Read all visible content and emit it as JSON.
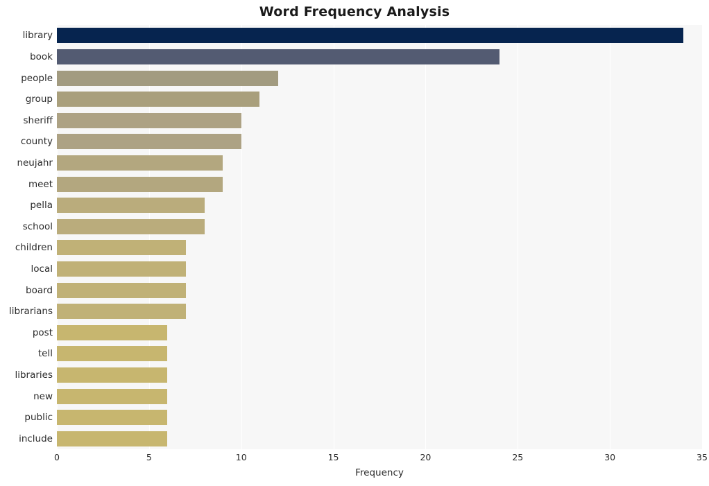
{
  "chart_data": {
    "type": "bar",
    "orientation": "horizontal",
    "title": "Word Frequency Analysis",
    "xlabel": "Frequency",
    "ylabel": "",
    "xlim": [
      0,
      35
    ],
    "xticks": [
      0,
      5,
      10,
      15,
      20,
      25,
      30,
      35
    ],
    "grid": true,
    "legend": null,
    "categories": [
      "library",
      "book",
      "people",
      "group",
      "sheriff",
      "county",
      "neujahr",
      "meet",
      "pella",
      "school",
      "children",
      "local",
      "board",
      "librarians",
      "post",
      "tell",
      "libraries",
      "new",
      "public",
      "include"
    ],
    "values": [
      34,
      24,
      12,
      11,
      10,
      10,
      9,
      9,
      8,
      8,
      7,
      7,
      7,
      7,
      6,
      6,
      6,
      6,
      6,
      6
    ],
    "bar_colors": [
      "#06244f",
      "#535b72",
      "#a29b80",
      "#a99f7c",
      "#ada284",
      "#ada284",
      "#b3a77f",
      "#b3a77f",
      "#baac7c",
      "#baac7c",
      "#c0b177",
      "#c0b177",
      "#c0b177",
      "#c0b177",
      "#c7b66f",
      "#c7b66f",
      "#c7b66f",
      "#c7b66f",
      "#c7b66f",
      "#c7b66f"
    ],
    "plot_background": "#f7f7f7",
    "figure_background": "#ffffff",
    "gridline_color": "#ffffff"
  }
}
